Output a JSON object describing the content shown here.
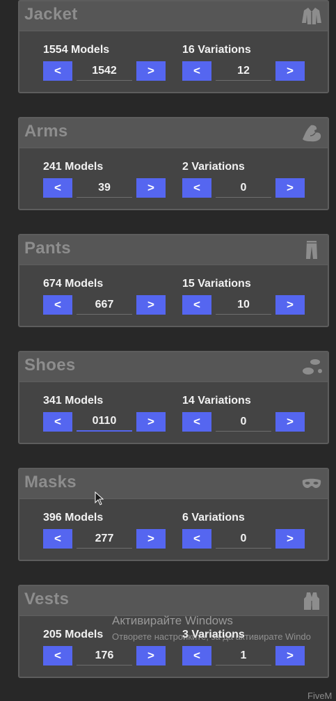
{
  "panels": [
    {
      "title": "Jacket",
      "icon": "jacket-icon",
      "models_label": "1554 Models",
      "models_value": "1542",
      "variations_label": "16 Variations",
      "variations_value": "12"
    },
    {
      "title": "Arms",
      "icon": "arm-icon",
      "models_label": "241 Models",
      "models_value": "39",
      "variations_label": "2 Variations",
      "variations_value": "0"
    },
    {
      "title": "Pants",
      "icon": "pants-icon",
      "models_label": "674 Models",
      "models_value": "667",
      "variations_label": "15 Variations",
      "variations_value": "10"
    },
    {
      "title": "Shoes",
      "icon": "shoe-prints-icon",
      "models_label": "341 Models",
      "models_value": "0110",
      "variations_label": "14 Variations",
      "variations_value": "0"
    },
    {
      "title": "Masks",
      "icon": "mask-icon",
      "models_label": "396 Models",
      "models_value": "277",
      "variations_label": "6 Variations",
      "variations_value": "0"
    },
    {
      "title": "Vests",
      "icon": "vest-icon",
      "models_label": "205 Models",
      "models_value": "176",
      "variations_label": "3 Variations",
      "variations_value": "1"
    }
  ],
  "buttons": {
    "prev": "<",
    "next": ">"
  },
  "overlay": {
    "activate_title": "Активирайте Windows",
    "activate_sub": "Отворете настройките, за да активирате Windo",
    "corner_text": "FiveM"
  },
  "colors": {
    "background": "#282828",
    "panel": "#444444",
    "panel_header": "#565656",
    "title": "#8d8d8d",
    "button": "#5566f0",
    "text": "#f2f2f2"
  }
}
